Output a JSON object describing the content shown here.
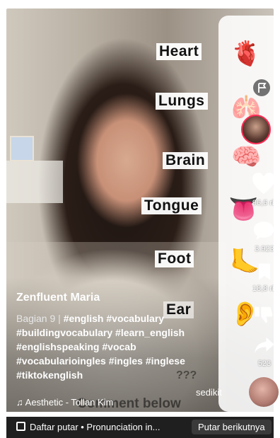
{
  "video": {
    "words": [
      "Heart",
      "Lungs",
      "Brain",
      "Tongue",
      "Foot",
      "Ear"
    ],
    "emojis": [
      "🫀",
      "🫁",
      "🧠",
      "👅",
      "🦶",
      "👂"
    ],
    "overlay_question": "???",
    "overlay_comment": "Comment below"
  },
  "author": {
    "username": "Zenfluent Maria"
  },
  "caption": {
    "part": "Bagian 9 | ",
    "text": "#english #vocabulary #buildingvocabulary #learn_english #englishspeaking #vocab #vocabularioingles #ingles #inglese #tiktokenglish",
    "more": "sedikit"
  },
  "music": {
    "label": "♫ Aesthetic - Tollan Kim"
  },
  "actions": {
    "likes": "96,6 rb",
    "comments": "3.923",
    "saves": "18,8 rb",
    "shares": "523"
  },
  "bottom": {
    "playlist": "Daftar putar • Pronunciation in...",
    "next": "Putar berikutnya"
  },
  "colors": {
    "accent": "#fe2c55",
    "bar": "#1f1f1f"
  }
}
